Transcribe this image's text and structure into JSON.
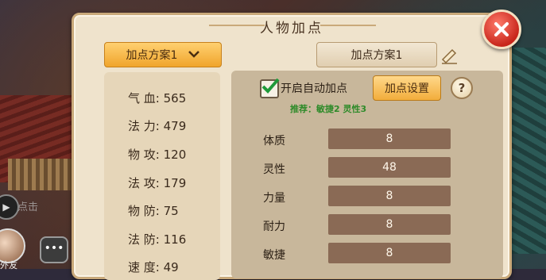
{
  "panel": {
    "title": "人物加点",
    "scheme_dropdown": "加点方案1",
    "scheme_tab": "加点方案1"
  },
  "stats": [
    {
      "label": "气 血:",
      "value": "565"
    },
    {
      "label": "法 力:",
      "value": "479"
    },
    {
      "label": "物 攻:",
      "value": "120"
    },
    {
      "label": "法 攻:",
      "value": "179"
    },
    {
      "label": "物 防:",
      "value": "75"
    },
    {
      "label": "法 防:",
      "value": "116"
    },
    {
      "label": "速 度:",
      "value": "49"
    }
  ],
  "auto": {
    "checked": true,
    "label": "开启自动加点",
    "settings_button": "加点设置",
    "help": "?"
  },
  "recommend_text": "推荐：敏捷2 灵性3",
  "attributes": [
    {
      "label": "体质",
      "value": "8"
    },
    {
      "label": "灵性",
      "value": "48"
    },
    {
      "label": "力量",
      "value": "8"
    },
    {
      "label": "耐力",
      "value": "8"
    },
    {
      "label": "敏捷",
      "value": "8"
    }
  ],
  "hud": {
    "hint": "点击",
    "chat_icon": "•••",
    "name": "外友"
  },
  "colors": {
    "accent_orange": "#f2ad3c",
    "close_red": "#c8261b",
    "recommend_green": "#2f8b2a",
    "attr_box": "#8a6a55"
  }
}
